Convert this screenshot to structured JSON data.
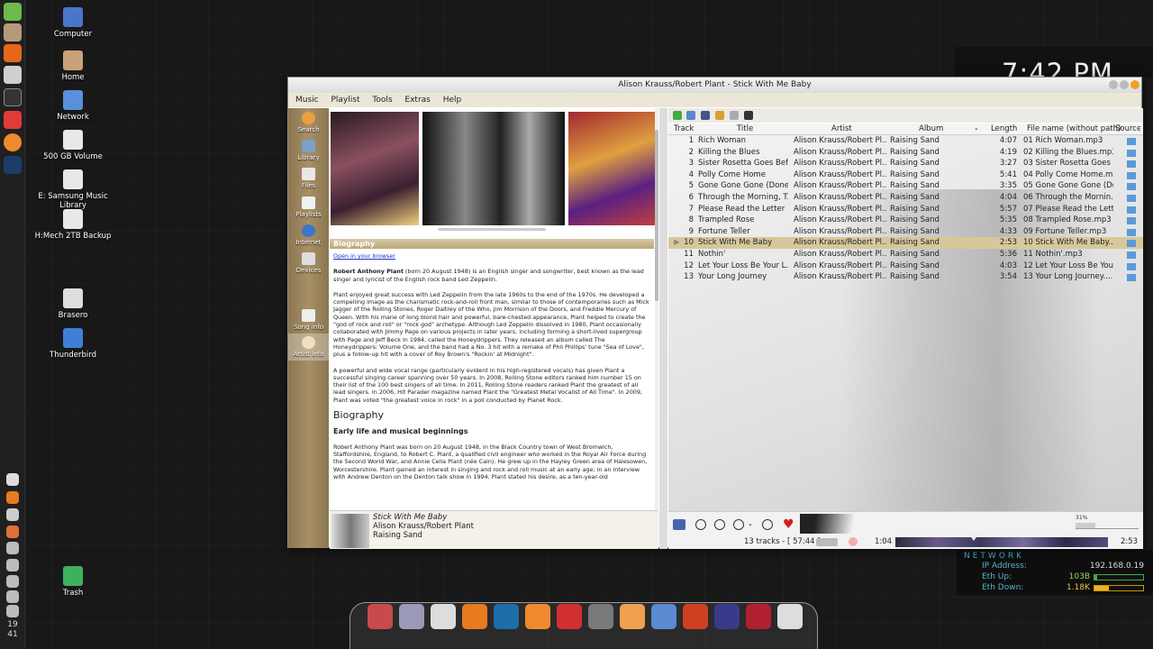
{
  "desktop": {
    "icons": [
      {
        "label": "Computer",
        "color": "#4a76c9"
      },
      {
        "label": "Home",
        "color": "#c9a27a"
      },
      {
        "label": "Network",
        "color": "#5a8fdc"
      },
      {
        "label": "500 GB Volume",
        "color": "#e8e8e8"
      },
      {
        "label": "E: Samsung Music Library",
        "color": "#e8e8e8"
      },
      {
        "label": "H:Mech 2TB Backup",
        "color": "#e8e8e8"
      },
      {
        "label": "Brasero",
        "color": "#dddddd"
      },
      {
        "label": "Thunderbird",
        "color": "#3f7fd8"
      },
      {
        "label": "Trash",
        "color": "#40b060"
      }
    ]
  },
  "panel": {
    "clock_hour": "19",
    "clock_min": "41"
  },
  "conky": {
    "time": "7:42 PM",
    "network_title": "NETWORK",
    "ip_label": "IP Address:",
    "ip_value": "192.168.0.19",
    "up_label": "Eth Up:",
    "up_value": "103B",
    "up_fraction": 0.05,
    "down_label": "Eth Down:",
    "down_value": "1.18K",
    "down_fraction": 0.3
  },
  "window": {
    "title": "Alison Krauss/Robert Plant - Stick With Me Baby"
  },
  "menu": [
    "Music",
    "Playlist",
    "Tools",
    "Extras",
    "Help"
  ],
  "sidebar": [
    "Search",
    "Library",
    "Files",
    "Playlists",
    "Internet",
    "Devices",
    "Song info",
    "Artist info"
  ],
  "bio": {
    "title": "Biography",
    "open_link": "Open in your browser",
    "name": "Robert Anthony Plant",
    "intro": "(born 20 August 1948) is an English singer and songwriter, best known as the lead singer and lyricist of the English rock band Led Zeppelin.",
    "p1": "Plant enjoyed great success with Led Zeppelin from the late 1960s to the end of the 1970s. He developed a compelling image as the charismatic rock-and-roll front man, similar to those of contemporaries such as Mick Jagger of the Rolling Stones, Roger Daltrey of the Who, Jim Morrison of the Doors, and Freddie Mercury of Queen. With his mane of long blond hair and powerful, bare-chested appearance, Plant helped to create the \"god of rock and roll\" or \"rock god\" archetype. Although Led Zeppelin dissolved in 1980, Plant occasionally collaborated with Jimmy Page on various projects in later years, including forming a short-lived supergroup with Page and Jeff Beck in 1984, called the Honeydrippers. They released an album called The Honeydrippers: Volume One, and the band had a No. 3 hit with a remake of Phil Phillips' tune \"Sea of Love\", plus a follow-up hit with a cover of Roy Brown's \"Rockin' at Midnight\".",
    "p2": "A powerful and wide vocal range (particularly evident in his high-registered vocals) has given Plant a successful singing career spanning over 50 years. In 2008, Rolling Stone editors ranked him number 15 on their list of the 100 best singers of all time. In 2011, Rolling Stone readers ranked Plant the greatest of all lead singers. In 2006, Hit Parader magazine named Plant the \"Greatest Metal Vocalist of All Time\". In 2009, Plant was voted \"the greatest voice in rock\" in a poll conducted by Planet Rock.",
    "h2": "Biography",
    "h3": "Early life and musical beginnings",
    "p3": "Robert Anthony Plant was born on 20 August 1948, in the Black Country town of West Bromwich, Staffordshire, England, to Robert C. Plant, a qualified civil engineer who worked in the Royal Air Force during the Second World War, and Annie Celia Plant (née Cain). He grew up in the Hayley Green area of Halesowen, Worcestershire. Plant gained an interest in singing and rock and roll music at an early age; in an interview with Andrew Denton on the Denton talk show in 1994, Plant stated his desire, as a ten-year-old"
  },
  "now_playing": {
    "title": "Stick With Me Baby",
    "artist": "Alison Krauss/Robert Plant",
    "album": "Raising Sand"
  },
  "columns": [
    "Track",
    "Title",
    "Artist",
    "Album",
    "Length",
    "File name (without path)",
    "Source"
  ],
  "tracks": [
    {
      "n": "1",
      "title": "Rich Woman",
      "artist": "Alison Krauss/Robert Pl...",
      "album": "Raising Sand",
      "len": "4:07",
      "file": "01 Rich Woman.mp3"
    },
    {
      "n": "2",
      "title": "Killing the Blues",
      "artist": "Alison Krauss/Robert Pl...",
      "album": "Raising Sand",
      "len": "4:19",
      "file": "02 Killing the Blues.mp3"
    },
    {
      "n": "3",
      "title": "Sister Rosetta Goes Bef...",
      "artist": "Alison Krauss/Robert Pl...",
      "album": "Raising Sand",
      "len": "3:27",
      "file": "03 Sister Rosetta Goes ..."
    },
    {
      "n": "4",
      "title": "Polly Come Home",
      "artist": "Alison Krauss/Robert Pl...",
      "album": "Raising Sand",
      "len": "5:41",
      "file": "04 Polly Come Home.mp3"
    },
    {
      "n": "5",
      "title": "Gone Gone Gone (Done...",
      "artist": "Alison Krauss/Robert Pl...",
      "album": "Raising Sand",
      "len": "3:35",
      "file": "05 Gone Gone Gone (Do..."
    },
    {
      "n": "6",
      "title": "Through the Morning, T...",
      "artist": "Alison Krauss/Robert Pl...",
      "album": "Raising Sand",
      "len": "4:04",
      "file": "06 Through the Mornin..."
    },
    {
      "n": "7",
      "title": "Please Read the Letter",
      "artist": "Alison Krauss/Robert Pl...",
      "album": "Raising Sand",
      "len": "5:57",
      "file": "07 Please Read the Lett..."
    },
    {
      "n": "8",
      "title": "Trampled Rose",
      "artist": "Alison Krauss/Robert Pl...",
      "album": "Raising Sand",
      "len": "5:35",
      "file": "08 Trampled Rose.mp3"
    },
    {
      "n": "9",
      "title": "Fortune Teller",
      "artist": "Alison Krauss/Robert Pl...",
      "album": "Raising Sand",
      "len": "4:33",
      "file": "09 Fortune Teller.mp3"
    },
    {
      "n": "10",
      "title": "Stick With Me Baby",
      "artist": "Alison Krauss/Robert Pl...",
      "album": "Raising Sand",
      "len": "2:53",
      "file": "10 Stick With Me Baby...."
    },
    {
      "n": "11",
      "title": "Nothin'",
      "artist": "Alison Krauss/Robert Pl...",
      "album": "Raising Sand",
      "len": "5:36",
      "file": "11 Nothin'.mp3"
    },
    {
      "n": "12",
      "title": "Let Your Loss Be Your L...",
      "artist": "Alison Krauss/Robert Pl...",
      "album": "Raising Sand",
      "len": "4:03",
      "file": "12 Let Your Loss Be You..."
    },
    {
      "n": "13",
      "title": "Your Long Journey",
      "artist": "Alison Krauss/Robert Pl...",
      "album": "Raising Sand",
      "len": "3:54",
      "file": "13 Your Long Journey...."
    }
  ],
  "current_track": 9,
  "status": {
    "tracks": "13 tracks - [ 57:44 ]",
    "elapsed": "1:04",
    "total": "2:53",
    "volume": "31%",
    "progress": 0.37,
    "volume_fraction": 0.31
  },
  "dock_colors": [
    "#c84a4a",
    "#9a9ab8",
    "#dddddd",
    "#e87a20",
    "#1b6ea8",
    "#f08a30",
    "#d23030",
    "#7a7a7a",
    "#f0a050",
    "#5a8ad0",
    "#d04020",
    "#3a3a8a",
    "#b02030",
    "#dddddd"
  ]
}
